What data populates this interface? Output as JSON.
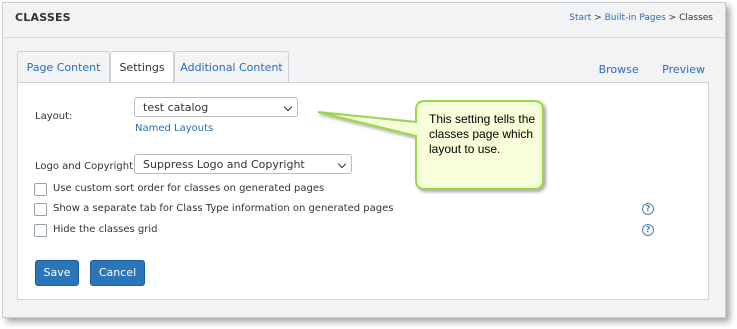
{
  "header": {
    "title": "CLASSES",
    "breadcrumb": {
      "start": "Start",
      "sep1": ">",
      "builtin": "Built-in Pages",
      "sep2": ">",
      "current": "Classes"
    }
  },
  "tabs": [
    {
      "label": "Page Content",
      "active": false
    },
    {
      "label": "Settings",
      "active": true
    },
    {
      "label": "Additional Content",
      "active": false
    }
  ],
  "right_links": {
    "browse": "Browse",
    "preview": "Preview"
  },
  "form": {
    "layout_label": "Layout:",
    "layout_value": "test catalog",
    "named_layouts_link": "Named Layouts",
    "logo_label": "Logo and Copyright:",
    "logo_value": "Suppress Logo and Copyright",
    "options": [
      {
        "label": "Use custom sort order for classes on generated pages",
        "checked": false,
        "help": false
      },
      {
        "label": "Show a separate tab for Class Type information on generated pages",
        "checked": false,
        "help": true
      },
      {
        "label": "Hide the classes grid",
        "checked": false,
        "help": true
      }
    ],
    "help_glyph": "?",
    "save_label": "Save",
    "cancel_label": "Cancel"
  },
  "callout": {
    "text": "This setting tells the classes page which layout to use."
  },
  "colors": {
    "accent": "#2b76b8",
    "link": "#2a6db5",
    "callout_fill": "#f6ffd9",
    "callout_border": "#9bd64a"
  }
}
